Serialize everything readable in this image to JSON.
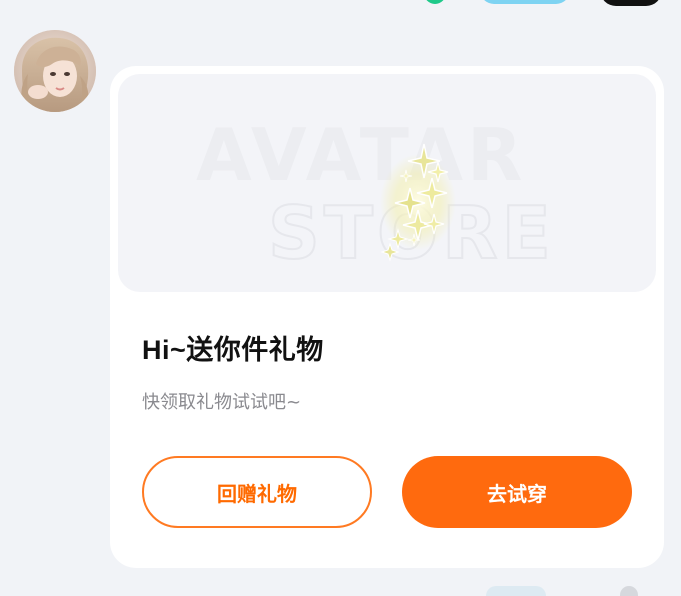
{
  "sender": {
    "avatar_alt": "sender avatar"
  },
  "gift_card": {
    "banner": {
      "watermark_line1": "AVATAR",
      "watermark_line2": "STORE"
    },
    "title": "Hi~送你件礼物",
    "subtitle": "快领取礼物试试吧~",
    "buttons": {
      "return_gift": "回赠礼物",
      "try_on": "去试穿"
    }
  },
  "colors": {
    "accent": "#FF6A0E",
    "outline_button_text": "#FF6A00",
    "background": "#F1F3F7",
    "card": "#FFFFFF",
    "banner": "#F3F4F8",
    "sparkle": "#E5E38A",
    "subtitle": "#8A8A8F",
    "title": "#111111"
  }
}
